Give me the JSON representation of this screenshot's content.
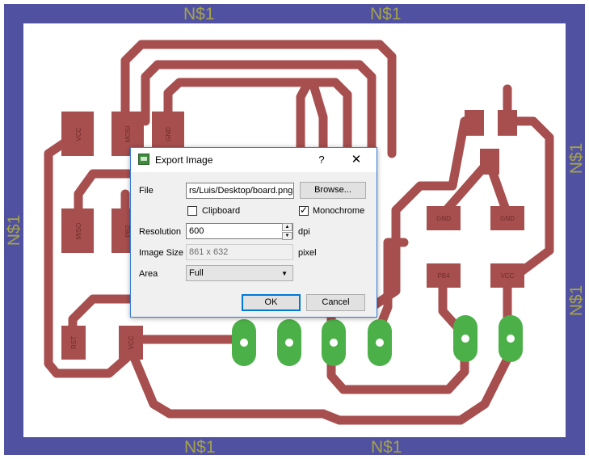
{
  "board": {
    "net_label": "N$1",
    "pads": {
      "smd_vcc_top": "VCC",
      "smd_mosi": "MOSI",
      "smd_gnd_top": "GND",
      "smd_miso": "MISO",
      "smd_pb2": "PB2",
      "smd_rst": "RST",
      "smd_vcc_bottom": "VCC",
      "smd_gnd_right_1": "GND",
      "smd_gnd_right_2": "GND",
      "smd_pb4": "PB4",
      "smd_vcc_right": "VCC"
    },
    "colors": {
      "frame": "#5151a1",
      "trace": "#a74f4f",
      "pad": "#a74f4f",
      "through_pad": "#4cb048",
      "net_label": "#a4a34a"
    }
  },
  "dialog": {
    "title": "Export Image",
    "help_label": "?",
    "close_label": "✕",
    "file_label": "File",
    "file_value": "rs/Luis/Desktop/board.png",
    "browse_label": "Browse...",
    "clipboard_label": "Clipboard",
    "clipboard_checked": false,
    "monochrome_label": "Monochrome",
    "monochrome_checked": true,
    "resolution_label": "Resolution",
    "resolution_value": "600",
    "resolution_unit": "dpi",
    "image_size_label": "Image Size",
    "image_size_value": "861 x 632",
    "image_size_unit": "pixel",
    "area_label": "Area",
    "area_value": "Full",
    "ok_label": "OK",
    "cancel_label": "Cancel"
  }
}
